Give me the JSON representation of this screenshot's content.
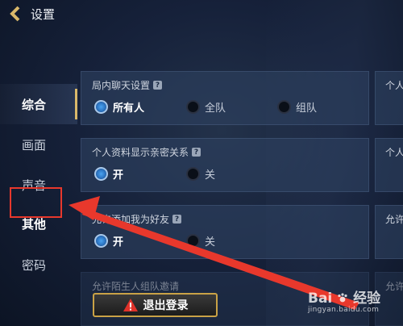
{
  "header": {
    "title": "设置",
    "back_icon": "chevron-left-icon",
    "accent_color": "#d9b86a"
  },
  "sidebar": {
    "items": [
      {
        "label": "综合",
        "active": true
      },
      {
        "label": "画面"
      },
      {
        "label": "声音"
      },
      {
        "label": "其他",
        "highlighted": true
      },
      {
        "label": "密码"
      }
    ]
  },
  "panels": [
    {
      "title": "局内聊天设置",
      "options": [
        {
          "label": "所有人",
          "selected": true
        },
        {
          "label": "全队"
        },
        {
          "label": "组队"
        }
      ]
    },
    {
      "title": "个人资料显示亲密关系",
      "options": [
        {
          "label": "开",
          "selected": true
        },
        {
          "label": "关"
        }
      ]
    },
    {
      "title": "允许添加我为好友",
      "options": [
        {
          "label": "开",
          "selected": true
        },
        {
          "label": "关"
        }
      ]
    },
    {
      "title": "允许陌生人组队邀请"
    }
  ],
  "right_panels": [
    {
      "title": "个人"
    },
    {
      "title": "个人"
    },
    {
      "title": "允许"
    },
    {
      "title": "允许"
    }
  ],
  "logout": {
    "label": "退出登录",
    "icon": "warning-icon",
    "border_color": "#c9a246"
  },
  "annotation": {
    "highlight_color": "#e8382c"
  },
  "watermark": {
    "brand": "Bai",
    "brand2": "经验",
    "sub": "jingyan.baidu.com"
  }
}
